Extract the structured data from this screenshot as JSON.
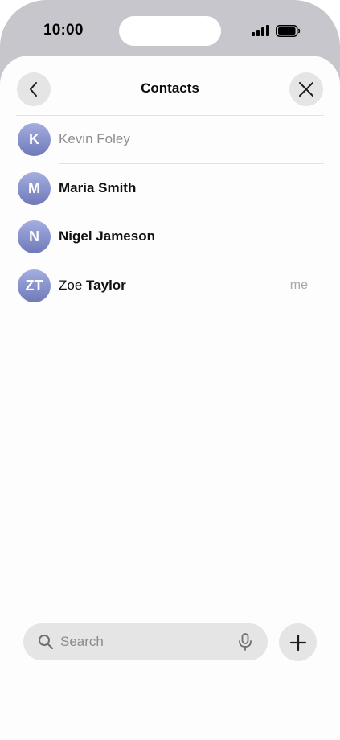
{
  "status_bar": {
    "time": "10:00",
    "signal_icon": "signal-bars-icon",
    "battery_icon": "battery-icon"
  },
  "header": {
    "title": "Contacts",
    "back_icon": "chevron-left-icon",
    "close_icon": "close-icon"
  },
  "contacts": [
    {
      "initials": "K",
      "first": "Kevin Foley",
      "last": "",
      "tag": "",
      "dimmed": true
    },
    {
      "initials": "M",
      "first": "",
      "last": "Maria Smith",
      "tag": "",
      "dimmed": false
    },
    {
      "initials": "N",
      "first": "",
      "last": "Nigel Jameson",
      "tag": "",
      "dimmed": false
    },
    {
      "initials": "ZT",
      "first": "Zoe ",
      "last": "Taylor",
      "tag": "me",
      "dimmed": false
    }
  ],
  "search": {
    "placeholder": "Search",
    "value": "",
    "search_icon": "search-icon",
    "mic_icon": "microphone-icon"
  },
  "add_button": {
    "icon": "plus-icon"
  },
  "colors": {
    "avatar_top": "#a4aee0",
    "avatar_bottom": "#6f79b8",
    "control_bg": "#e5e5e6",
    "device_frame": "#c7c6cc"
  }
}
